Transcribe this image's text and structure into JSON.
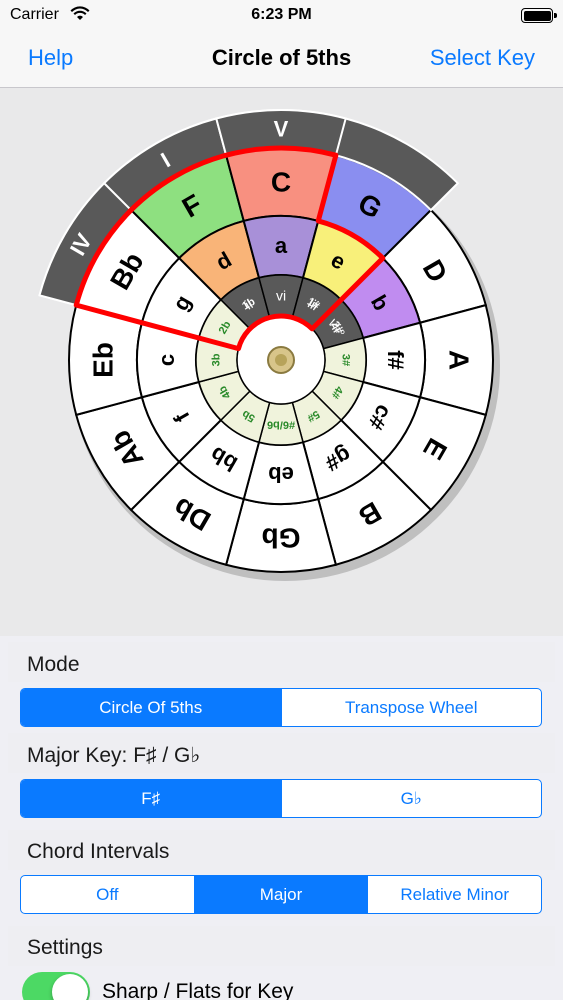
{
  "status": {
    "carrier": "Carrier",
    "time": "6:23 PM"
  },
  "nav": {
    "left": "Help",
    "title": "Circle of 5ths",
    "right": "Select Key"
  },
  "wheel": {
    "roman_top": [
      "IV",
      "I",
      "V"
    ],
    "selected_majors": [
      "F",
      "C",
      "G"
    ],
    "selected_minors": [
      "d",
      "a",
      "e",
      "b"
    ],
    "selected_diminished": "b",
    "roman_inner": [
      "ii",
      "vi",
      "iii",
      "vii°"
    ],
    "outer_majors": [
      "F",
      "C",
      "G",
      "D",
      "A",
      "E",
      "B",
      "Gb",
      "Db",
      "Ab",
      "Eb",
      "Bb"
    ],
    "minors": [
      "d",
      "a",
      "e",
      "b",
      "f#",
      "c#",
      "g#",
      "eb",
      "bb",
      "f",
      "c",
      "g"
    ],
    "accidentals": [
      "1b",
      "",
      "1#",
      "2#",
      "3#",
      "4#",
      "5#",
      "#6/b6",
      "5b",
      "4b",
      "3b",
      "2b"
    ],
    "colors": {
      "F": "#8ee080",
      "C": "#f89080",
      "G": "#8a8ef0",
      "d": "#f9b478",
      "a": "#a890d8",
      "e": "#f8f07a",
      "b": "#c08cf0",
      "highlight": "#ff0000",
      "band": "#595959"
    }
  },
  "mode": {
    "label": "Mode",
    "options": [
      "Circle Of 5ths",
      "Transpose Wheel"
    ],
    "selected": 0
  },
  "major_key": {
    "label": "Major Key: F♯ / G♭",
    "options": [
      "F♯",
      "G♭"
    ],
    "selected": 0
  },
  "chord_intervals": {
    "label": "Chord Intervals",
    "options": [
      "Off",
      "Major",
      "Relative Minor"
    ],
    "selected": 1
  },
  "settings": {
    "label": "Settings",
    "item": "Sharp / Flats for Key"
  }
}
